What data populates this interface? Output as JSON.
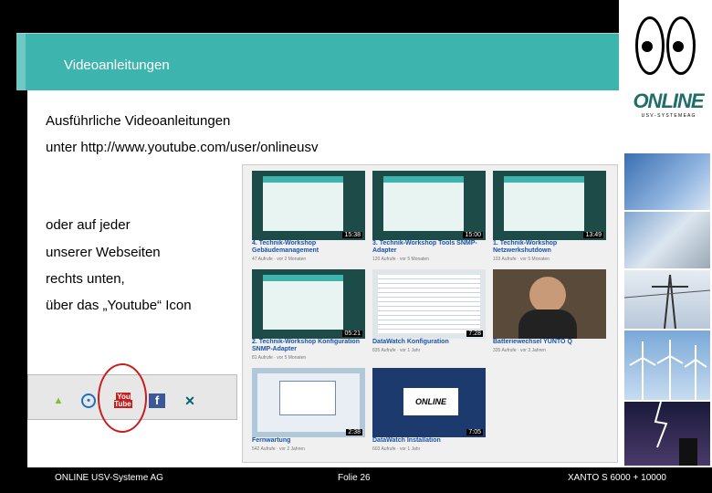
{
  "slide": {
    "title": "Videoanleitungen",
    "intro_line1": "Ausführliche Videoanleitungen",
    "intro_line2": "unter http://www.youtube.com/user/onlineusv",
    "body_line1": "oder auf jeder",
    "body_line2": "unserer Webseiten",
    "body_line3": "rechts unten,",
    "body_line4": "über das „Youtube“ Icon"
  },
  "brand": {
    "logo_text": "ONLINE",
    "logo_sub": "U S V - S Y S T E M E   A G",
    "accent": "#3eb4ae"
  },
  "videos": [
    {
      "title": "4. Technik-Workshop Gebäudemanagement",
      "meta": "47 Aufrufe · vor 2 Monaten",
      "duration": "15:38"
    },
    {
      "title": "3. Technik-Workshop Tools SNMP-Adapter",
      "meta": "120 Aufrufe · vor 5 Monaten",
      "duration": "15:00"
    },
    {
      "title": "1. Technik-Workshop Netzwerkshutdown",
      "meta": "103 Aufrufe · vor 5 Monaten",
      "duration": "13:49"
    },
    {
      "title": "2. Technik-Workshop Konfiguration SNMP-Adapter",
      "meta": "81 Aufrufe · vor 5 Monaten",
      "duration": "05:21"
    },
    {
      "title": "DataWatch Konfiguration",
      "meta": "835 Aufrufe · vor 1 Jahr",
      "duration": "7:28"
    },
    {
      "title": "Batteriewechsel YUNTO Q",
      "meta": "335 Aufrufe · vor 3 Jahren",
      "duration": ""
    },
    {
      "title": "Fernwartung",
      "meta": "542 Aufrufe · vor 2 Jahren",
      "duration": "2:38"
    },
    {
      "title": "DataWatch Installation",
      "meta": "603 Aufrufe · vor 1 Jahr",
      "duration": "7:05"
    }
  ],
  "social_icons": [
    "android-icon",
    "app-icon",
    "youtube-icon",
    "facebook-icon",
    "xing-icon"
  ],
  "youtube_icon_label": "You Tube",
  "footer": {
    "company": "ONLINE USV-Systeme AG",
    "page": "Folie 26",
    "product": "XANTO S 6000 + 10000"
  }
}
